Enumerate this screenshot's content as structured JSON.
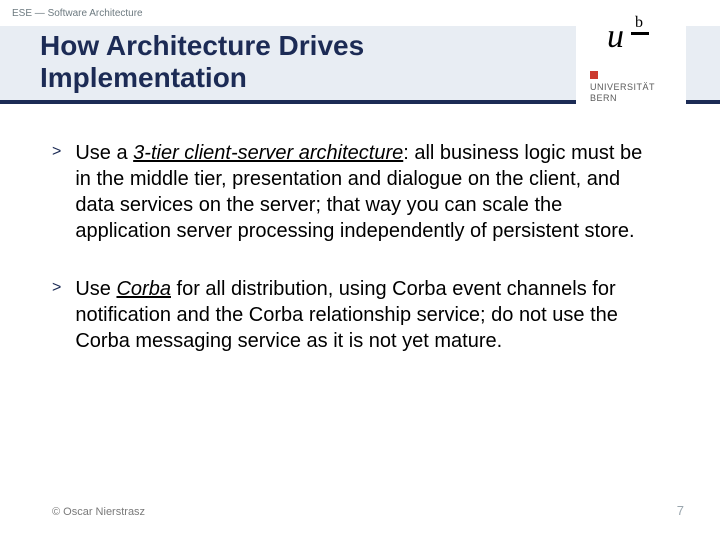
{
  "header": {
    "course_label": "ESE — Software Architecture",
    "title_line1": "How Architecture Drives",
    "title_line2": "Implementation"
  },
  "logo": {
    "u": "u",
    "b": "b",
    "uni_line1": "UNIVERSITÄT",
    "uni_line2": "BERN"
  },
  "bullets": [
    {
      "marker": ">",
      "lead": "Use a ",
      "key": "3-tier client-server architecture",
      "rest": ": all business logic must be in the middle tier, presentation and dialogue on the client, and data services on the server; that way you can scale the application server processing independently of persistent store."
    },
    {
      "marker": ">",
      "lead": "Use ",
      "key": "Corba",
      "rest": " for all distribution, using Corba event channels for notification and the Corba relationship service; do not use the Corba messaging service as it is not yet mature."
    }
  ],
  "footer": {
    "copyright": "© Oscar Nierstrasz",
    "page": "7"
  }
}
